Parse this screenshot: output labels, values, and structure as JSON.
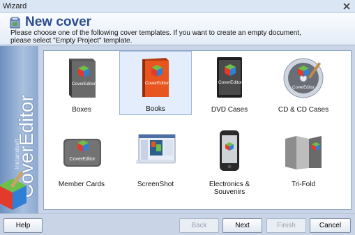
{
  "window": {
    "title": "Wizard"
  },
  "header": {
    "title": "New cover",
    "description_line1": "Please choose one of the following cover templates. If you want to create an empty document,",
    "description_line2": "please select \"Empty Project\" template."
  },
  "sidebar": {
    "brand_small": "Instandsoft",
    "brand": "CoverEditor"
  },
  "templates": [
    {
      "label": "Boxes",
      "icon": "box-icon",
      "selected": false
    },
    {
      "label": "Books",
      "icon": "book-icon",
      "selected": true
    },
    {
      "label": "DVD Cases",
      "icon": "dvd-case-icon",
      "selected": false
    },
    {
      "label": "CD & CD Cases",
      "icon": "cd-icon",
      "selected": false
    },
    {
      "label": "Member Cards",
      "icon": "member-card-icon",
      "selected": false
    },
    {
      "label": "ScreenShot",
      "icon": "screenshot-icon",
      "selected": false
    },
    {
      "label": "Electronics & Souvenirs",
      "icon": "phone-icon",
      "selected": false
    },
    {
      "label": "Tri-Fold",
      "icon": "trifold-icon",
      "selected": false
    }
  ],
  "icon_text": "CoverEditor",
  "footer": {
    "help": "Help",
    "back": "Back",
    "next": "Next",
    "finish": "Finish",
    "cancel": "Cancel"
  },
  "colors": {
    "selected_bg": "#e3edfb",
    "header_title": "#2c4d8f",
    "book_orange": "#e8551e"
  }
}
